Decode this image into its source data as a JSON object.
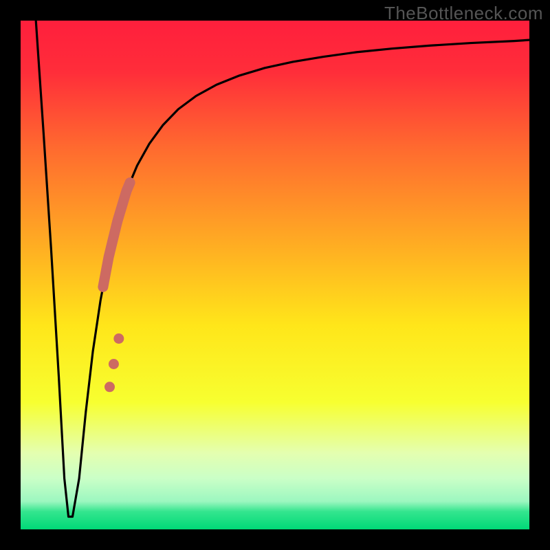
{
  "watermark": "TheBottleneck.com",
  "colors": {
    "frame": "#000000",
    "curve": "#000000",
    "highlight": "#cd6a62"
  },
  "chart_data": {
    "type": "line",
    "title": "",
    "xlabel": "",
    "ylabel": "",
    "xlim": [
      0,
      100
    ],
    "ylim": [
      0,
      100
    ],
    "grid": false,
    "background_gradient": {
      "stops": [
        {
          "pos": 0.0,
          "color": "#ff1f3c"
        },
        {
          "pos": 0.1,
          "color": "#ff2d3a"
        },
        {
          "pos": 0.25,
          "color": "#ff6a2f"
        },
        {
          "pos": 0.45,
          "color": "#ffb022"
        },
        {
          "pos": 0.6,
          "color": "#ffe61a"
        },
        {
          "pos": 0.75,
          "color": "#f7ff30"
        },
        {
          "pos": 0.85,
          "color": "#e4ffb0"
        },
        {
          "pos": 0.9,
          "color": "#caffc7"
        },
        {
          "pos": 0.945,
          "color": "#9cf7c0"
        },
        {
          "pos": 0.965,
          "color": "#34e58e"
        },
        {
          "pos": 1.0,
          "color": "#00d977"
        }
      ]
    },
    "series": [
      {
        "name": "bottleneck-curve",
        "x": [
          3.0,
          4.5,
          6.0,
          7.5,
          8.6,
          9.4,
          10.2,
          11.5,
          12.8,
          14.2,
          15.7,
          17.3,
          19.0,
          20.8,
          22.9,
          25.3,
          28.0,
          31.0,
          34.5,
          38.5,
          43.0,
          48.0,
          53.5,
          59.5,
          66.0,
          73.0,
          80.5,
          88.5,
          97.0,
          100.0
        ],
        "y": [
          100.0,
          78.0,
          55.0,
          30.0,
          10.0,
          2.5,
          2.5,
          10.0,
          23.0,
          35.0,
          45.0,
          53.5,
          60.5,
          66.5,
          71.5,
          75.8,
          79.5,
          82.6,
          85.2,
          87.4,
          89.2,
          90.7,
          91.9,
          92.9,
          93.8,
          94.5,
          95.1,
          95.6,
          96.0,
          96.2
        ]
      }
    ],
    "highlight_segment": {
      "series": "bottleneck-curve",
      "x_start": 16.2,
      "x_end": 21.5,
      "note": "thick salmon overlay on rising part of curve"
    },
    "highlight_points": [
      {
        "x": 17.5,
        "y": 28.0
      },
      {
        "x": 18.3,
        "y": 32.5
      },
      {
        "x": 19.3,
        "y": 37.5
      }
    ],
    "flat_minimum": {
      "x_start": 8.6,
      "x_end": 10.2,
      "y": 2.5
    }
  }
}
